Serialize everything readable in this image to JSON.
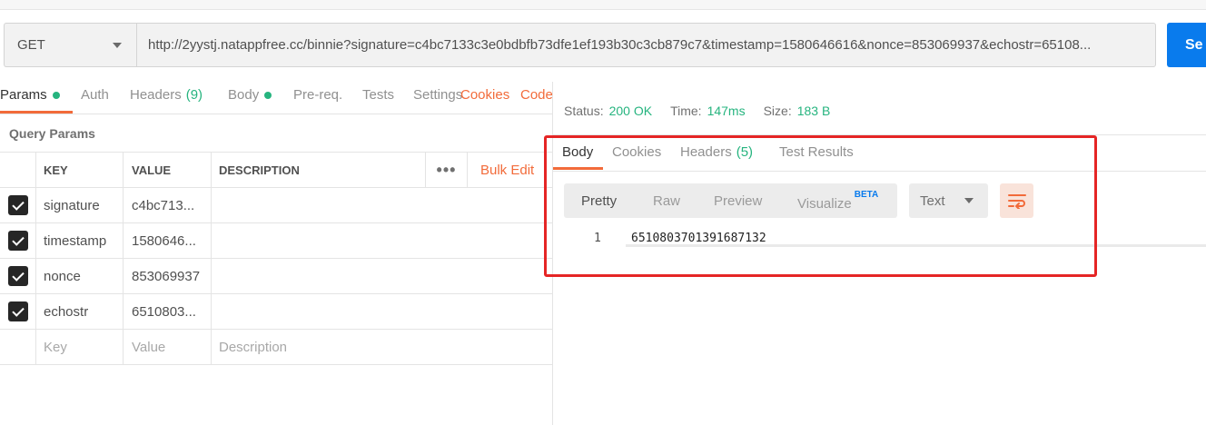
{
  "request": {
    "method": "GET",
    "url": "http://2yystj.natappfree.cc/binnie?signature=c4bc7133c3e0bdbfb73dfe1ef193b30c3cb879c7&timestamp=1580646616&nonce=853069937&echostr=65108...",
    "send_label": "Se"
  },
  "request_tabs": {
    "params": "Params",
    "auth": "Auth",
    "headers": "Headers",
    "headers_count": "(9)",
    "body": "Body",
    "prereq": "Pre-req.",
    "tests": "Tests",
    "settings": "Settings",
    "cookies": "Cookies",
    "code": "Code"
  },
  "query_params": {
    "title": "Query Params",
    "columns": {
      "key": "KEY",
      "value": "VALUE",
      "description": "DESCRIPTION"
    },
    "more": "•••",
    "bulk_edit": "Bulk Edit",
    "rows": [
      {
        "key": "signature",
        "value": "c4bc713...",
        "description": ""
      },
      {
        "key": "timestamp",
        "value": "1580646...",
        "description": ""
      },
      {
        "key": "nonce",
        "value": "853069937",
        "description": ""
      },
      {
        "key": "echostr",
        "value": "6510803...",
        "description": ""
      }
    ],
    "placeholders": {
      "key": "Key",
      "value": "Value",
      "description": "Description"
    }
  },
  "response": {
    "status_label": "Status:",
    "status": "200 OK",
    "time_label": "Time:",
    "time": "147ms",
    "size_label": "Size:",
    "size": "183 B",
    "tabs": {
      "body": "Body",
      "cookies": "Cookies",
      "headers": "Headers",
      "headers_count": "(5)",
      "test_results": "Test Results"
    },
    "view_modes": {
      "pretty": "Pretty",
      "raw": "Raw",
      "preview": "Preview",
      "visualize": "Visualize",
      "beta": "BETA"
    },
    "format": "Text",
    "lines": [
      {
        "number": "1",
        "text": "6510803701391687132"
      }
    ]
  },
  "colors": {
    "accent": "#f26b3a",
    "success": "#26b47f",
    "send": "#097bed",
    "highlight": "#e52525"
  }
}
